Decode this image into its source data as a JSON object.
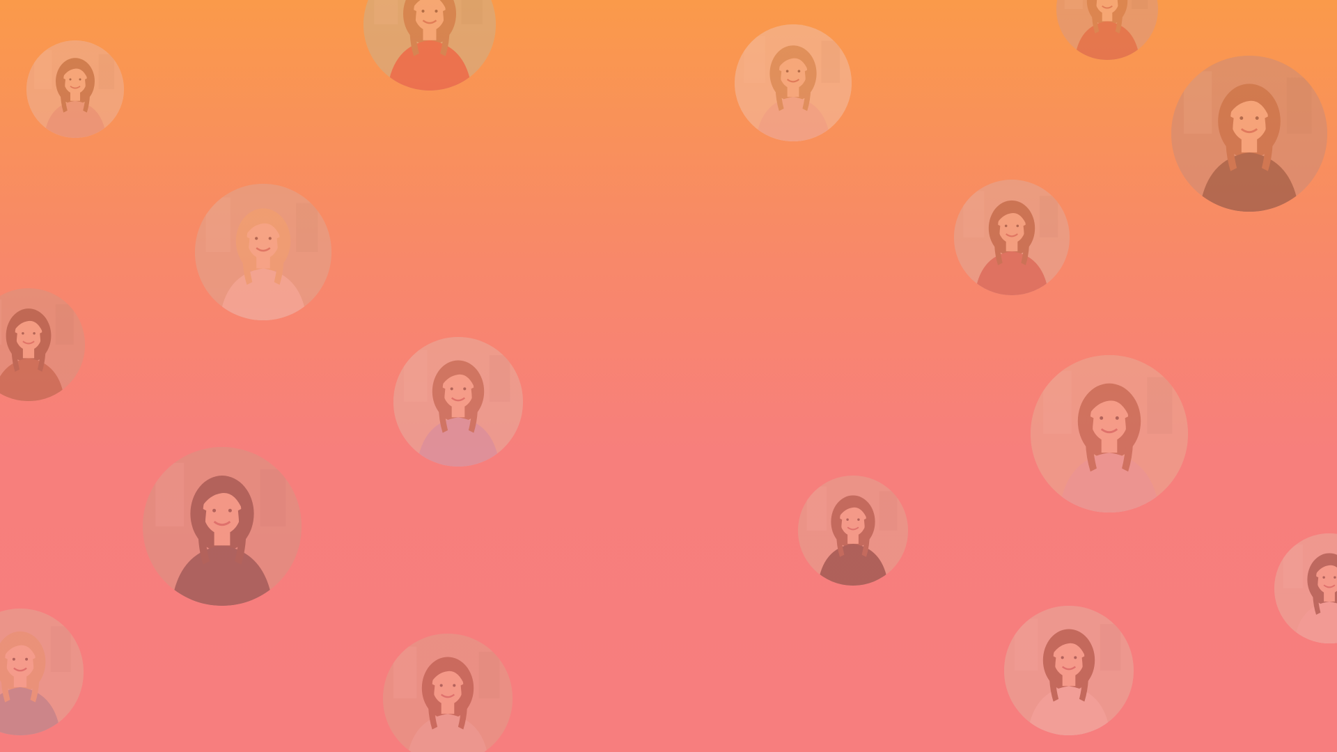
{
  "background": {
    "gradient_top": "#fa9a4a",
    "gradient_bottom": "#f77e7e"
  },
  "avatars": [
    {
      "icon": "portrait-photo",
      "palette": {
        "bg": "#e9c7b0",
        "hair": "#8a5a3c",
        "cloth": "#d7a0a0",
        "skin": "#f1c8ae"
      }
    },
    {
      "icon": "portrait-photo",
      "palette": {
        "bg": "#b7c49a",
        "hair": "#9a6b45",
        "cloth": "#d6393a",
        "skin": "#f0c6aa"
      }
    },
    {
      "icon": "portrait-photo",
      "palette": {
        "bg": "#efd7c4",
        "hair": "#b58a5f",
        "cloth": "#e7c0c3",
        "skin": "#f3cdb3"
      }
    },
    {
      "icon": "portrait-photo",
      "palette": {
        "bg": "#c9a08e",
        "hair": "#a86a48",
        "cloth": "#c2443d",
        "skin": "#f1c5a9"
      }
    },
    {
      "icon": "portrait-photo",
      "palette": {
        "bg": "#b28d80",
        "hair": "#8c5136",
        "cloth": "#3b2b2c",
        "skin": "#f2c6aa"
      }
    },
    {
      "icon": "portrait-photo",
      "palette": {
        "bg": "#d2b4a4",
        "hair": "#e1be86",
        "cloth": "#ead3d3",
        "skin": "#f4cfb7"
      }
    },
    {
      "icon": "portrait-photo",
      "palette": {
        "bg": "#d5b8b0",
        "hair": "#7f4a34",
        "cloth": "#b24b4f",
        "skin": "#efc3a6"
      }
    },
    {
      "icon": "portrait-photo",
      "palette": {
        "bg": "#c7988a",
        "hair": "#5d3427",
        "cloth": "#8c4a32",
        "skin": "#efbfa3"
      }
    },
    {
      "icon": "portrait-photo",
      "palette": {
        "bg": "#dcc2bb",
        "hair": "#8b5a44",
        "cloth": "#b6a8d6",
        "skin": "#f2c8ae"
      }
    },
    {
      "icon": "portrait-photo",
      "palette": {
        "bg": "#e0bca9",
        "hair": "#8a5238",
        "cloth": "#d9b4be",
        "skin": "#f3c7aa"
      }
    },
    {
      "icon": "portrait-photo",
      "palette": {
        "bg": "#c79a90",
        "hair": "#3b2a2a",
        "cloth": "#2d2a33",
        "skin": "#ecbca1"
      }
    },
    {
      "icon": "portrait-photo",
      "palette": {
        "bg": "#d8b1a4",
        "hair": "#6b3f2f",
        "cloth": "#2f2626",
        "skin": "#f0c3a7"
      }
    },
    {
      "icon": "portrait-photo",
      "palette": {
        "bg": "#e0c0b9",
        "hair": "#5a3a33",
        "cloth": "#e8c7c7",
        "skin": "#f1c4ab"
      }
    },
    {
      "icon": "portrait-photo",
      "palette": {
        "bg": "#d8b6aa",
        "hair": "#d4ae7c",
        "cloth": "#7e8aa8",
        "skin": "#f2c9ae"
      }
    },
    {
      "icon": "portrait-photo",
      "palette": {
        "bg": "#d4a89a",
        "hair": "#7a3f2e",
        "cloth": "#d9bcb5",
        "skin": "#f0c0a4"
      }
    },
    {
      "icon": "portrait-photo",
      "palette": {
        "bg": "#dcbdb6",
        "hair": "#6b3c2c",
        "cloth": "#e8d2d0",
        "skin": "#f2c6ab"
      }
    }
  ]
}
